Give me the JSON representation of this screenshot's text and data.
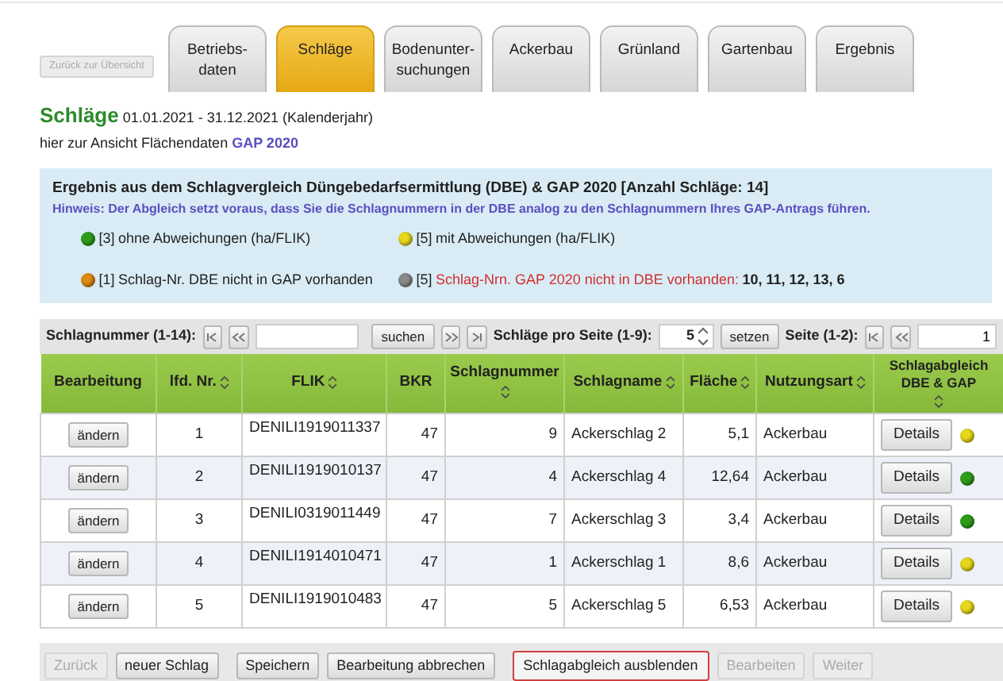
{
  "back_button": {
    "label": "Zurück zur Übersicht",
    "disabled": true
  },
  "tabs": [
    {
      "label": "Betriebs-\ndaten",
      "selected": false
    },
    {
      "label": "Schläge",
      "selected": true
    },
    {
      "label": "Bodenunter-\nsuchungen",
      "selected": false
    },
    {
      "label": "Ackerbau",
      "selected": false
    },
    {
      "label": "Grünland",
      "selected": false
    },
    {
      "label": "Gartenbau",
      "selected": false
    },
    {
      "label": "Ergebnis",
      "selected": false
    }
  ],
  "heading": {
    "title": "Schläge",
    "period": "01.01.2021 - 31.12.2021 (Kalenderjahr)"
  },
  "subheading": {
    "text": "hier zur Ansicht Flächendaten",
    "link": "GAP 2020"
  },
  "result_box": {
    "title": "Ergebnis aus dem Schlagvergleich Düngebedarfsermittlung (DBE) & GAP 2020 [Anzahl Schläge: 14]",
    "hint": "Hinweis: Der Abgleich setzt voraus, dass Sie die Schlagnummern in der DBE analog zu den Schlagnummern Ihres GAP-Antrags führen.",
    "legend": [
      {
        "color": "#2e9e1a",
        "count": "[3]",
        "label": "ohne Abweichungen (ha/FLIK)",
        "alert": false
      },
      {
        "color": "#e8d81c",
        "count": "[5]",
        "label": "mit Abweichungen (ha/FLIK)",
        "alert": false
      },
      {
        "color": "#e08a10",
        "count": "[1]",
        "label": "Schlag-Nr. DBE nicht in GAP vorhanden",
        "alert": false
      },
      {
        "color": "#8a8a8a",
        "count": "[5]",
        "label": "Schlag-Nrn. GAP 2020 nicht in DBE vorhanden:",
        "alert": true,
        "numbers": "10, 11, 12, 13, 6"
      }
    ]
  },
  "pager": {
    "search_label": "Schlagnummer (1-14):",
    "search_button": "suchen",
    "per_page_label": "Schläge pro Seite (1-9):",
    "per_page_value": "5",
    "set_button": "setzen",
    "page_label": "Seite (1-2):",
    "page_value": "1"
  },
  "table": {
    "columns": [
      {
        "label": "Bearbeitung",
        "sortable": false
      },
      {
        "label": "lfd. Nr.",
        "sortable": true
      },
      {
        "label": "FLIK",
        "sortable": true
      },
      {
        "label": "BKR",
        "sortable": false
      },
      {
        "label": "Schlagnummer",
        "sortable": true
      },
      {
        "label": "Schlagname",
        "sortable": true
      },
      {
        "label": "Fläche",
        "sortable": true
      },
      {
        "label": "Nutzungsart",
        "sortable": true
      },
      {
        "label": "Schlagabgleich DBE & GAP",
        "sortable": true
      }
    ],
    "rows": [
      {
        "action": "ändern",
        "nr": "1",
        "flik": "DENILI1919011337",
        "bkr": "47",
        "schlagnummer": "9",
        "schlagname": "Ackerschlag 2",
        "flaeche": "5,1",
        "nutzungsart": "Ackerbau",
        "details": "Details",
        "color": "#e8d81c"
      },
      {
        "action": "ändern",
        "nr": "2",
        "flik": "DENILI1919010137",
        "bkr": "47",
        "schlagnummer": "4",
        "schlagname": "Ackerschlag 4",
        "flaeche": "12,64",
        "nutzungsart": "Ackerbau",
        "details": "Details",
        "color": "#2e9e1a"
      },
      {
        "action": "ändern",
        "nr": "3",
        "flik": "DENILI0319011449",
        "bkr": "47",
        "schlagnummer": "7",
        "schlagname": "Ackerschlag 3",
        "flaeche": "3,4",
        "nutzungsart": "Ackerbau",
        "details": "Details",
        "color": "#2e9e1a"
      },
      {
        "action": "ändern",
        "nr": "4",
        "flik": "DENILI1914010471",
        "bkr": "47",
        "schlagnummer": "1",
        "schlagname": "Ackerschlag 1",
        "flaeche": "8,6",
        "nutzungsart": "Ackerbau",
        "details": "Details",
        "color": "#e8d81c"
      },
      {
        "action": "ändern",
        "nr": "5",
        "flik": "DENILI1919010483",
        "bkr": "47",
        "schlagnummer": "5",
        "schlagname": "Ackerschlag 5",
        "flaeche": "6,53",
        "nutzungsart": "Ackerbau",
        "details": "Details",
        "color": "#e8d81c"
      }
    ]
  },
  "footer_buttons": [
    {
      "label": "Zurück",
      "disabled": true,
      "highlighted": false
    },
    {
      "label": "neuer Schlag",
      "disabled": false,
      "highlighted": false
    },
    {
      "label": "Speichern",
      "disabled": false,
      "highlighted": false
    },
    {
      "label": "Bearbeitung abbrechen",
      "disabled": false,
      "highlighted": false
    },
    {
      "label": "Schlagabgleich ausblenden",
      "disabled": false,
      "highlighted": true
    },
    {
      "label": "Bearbeiten",
      "disabled": true,
      "highlighted": false
    },
    {
      "label": "Weiter",
      "disabled": true,
      "highlighted": false
    }
  ]
}
